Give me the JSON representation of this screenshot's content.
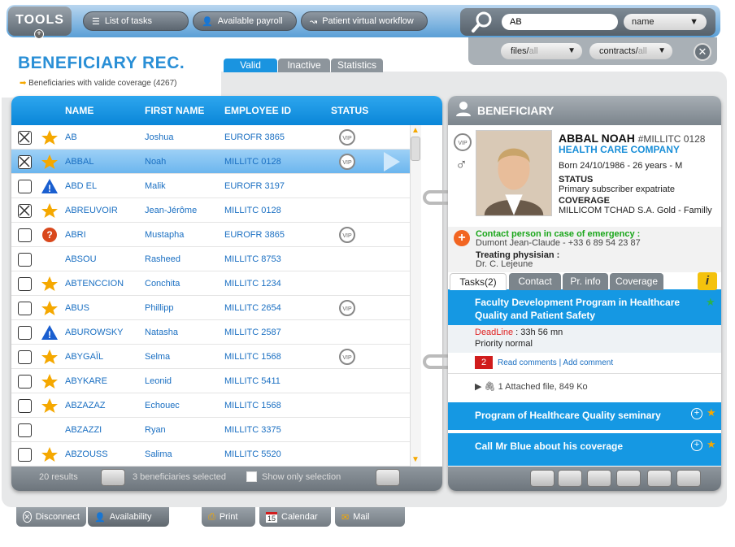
{
  "toolbar": {
    "tools_label": "TOOLS"
  },
  "nav": {
    "list_of_tasks": "List of tasks",
    "available_payroll": "Available payroll",
    "patient_workflow": "Patient virtual workflow"
  },
  "search": {
    "value": "AB",
    "field": "name"
  },
  "filters": {
    "files_label": "files/",
    "files_value": "all",
    "contracts_label": "contracts/",
    "contracts_value": "all"
  },
  "page": {
    "title": "BENEFICIARY REC.",
    "subtitle": "Beneficiaries with valide coverage (4267)"
  },
  "tabs": [
    "Valid",
    "Inactive",
    "Statistics"
  ],
  "table": {
    "headers": [
      "NAME",
      "FIRST NAME",
      "EMPLOYEE ID",
      "STATUS"
    ],
    "rows": [
      {
        "name": "AB",
        "first": "Joshua",
        "id": "EUROFR 3865",
        "checked": true,
        "icon": "star-icon",
        "vip": true
      },
      {
        "name": "ABBAL",
        "first": "Noah",
        "id": "MILLITC 0128",
        "checked": true,
        "icon": "star-icon",
        "vip": true,
        "selected": true
      },
      {
        "name": "ABD EL",
        "first": "Malik",
        "id": "EUROFR 3197",
        "checked": false,
        "icon": "warning-icon",
        "vip": false
      },
      {
        "name": "ABREUVOIR",
        "first": "Jean-Jérôme",
        "id": "MILLITC 0128",
        "checked": true,
        "icon": "star-icon",
        "vip": false
      },
      {
        "name": "ABRI",
        "first": "Mustapha",
        "id": "EUROFR 3865",
        "checked": false,
        "icon": "question-icon",
        "vip": true
      },
      {
        "name": "ABSOU",
        "first": "Rasheed",
        "id": "MILLITC 8753",
        "checked": false,
        "icon": "",
        "vip": false
      },
      {
        "name": "ABTENCCION",
        "first": "Conchita",
        "id": "MILLITC 1234",
        "checked": false,
        "icon": "star-icon",
        "vip": false
      },
      {
        "name": "ABUS",
        "first": "Phillipp",
        "id": "MILLITC 2654",
        "checked": false,
        "icon": "star-icon",
        "vip": true
      },
      {
        "name": "ABUROWSKY",
        "first": "Natasha",
        "id": "MILLITC 2587",
        "checked": false,
        "icon": "warning-icon",
        "vip": false
      },
      {
        "name": "ABYGAÏL",
        "first": "Selma",
        "id": "MILLITC 1568",
        "checked": false,
        "icon": "star-icon",
        "vip": true
      },
      {
        "name": "ABYKARE",
        "first": "Leonid",
        "id": "MILLITC 5411",
        "checked": false,
        "icon": "star-icon",
        "vip": false
      },
      {
        "name": "ABZAZAZ",
        "first": "Echouec",
        "id": "MILLITC 1568",
        "checked": false,
        "icon": "star-icon",
        "vip": false
      },
      {
        "name": "ABZAZZI",
        "first": "Ryan",
        "id": "MILLITC 3375",
        "checked": false,
        "icon": "",
        "vip": false
      },
      {
        "name": "ABZOUSS",
        "first": "Salima",
        "id": "MILLITC 5520",
        "checked": false,
        "icon": "star-icon",
        "vip": false
      }
    ],
    "vip_label": "VIP"
  },
  "listfooter": {
    "results": "20 results",
    "selected": "3 beneficiaries selected",
    "show_only": "Show only selection"
  },
  "beneficiary": {
    "header": "BENEFICIARY",
    "name": "ABBAL NOAH",
    "id": "#MILLITC 0128",
    "company": "HEALTH CARE COMPANY",
    "born": "Born 24/10/1986 - 26 years - M",
    "status_label": "STATUS",
    "status": "Primary subscriber expatriate",
    "coverage_label": "COVERAGE",
    "coverage": "MILLICOM TCHAD S.A. Gold - Familly",
    "emergency_label": "Contact person in case of emergency :",
    "emergency": "Dumont Jean-Claude - +33 6 89 54 23 87",
    "physician_label": "Treating physisian :",
    "physician": "Dr. C. Lejeune"
  },
  "btabs": [
    "Tasks(2)",
    "Contact",
    "Pr. info",
    "Coverage"
  ],
  "tasks": {
    "t1_title": "Faculty Development Program in Healthcare Quality and Patient Safety",
    "deadline_label": "DeadLine",
    "deadline": " : 33h 56 mn",
    "priority": "Priority normal",
    "comments_count": "2",
    "read_comments": "Read comments",
    "add_comment": "Add comment",
    "attached": "1 Attached file, 849 Ko",
    "t2_title": "Program of Healthcare Quality seminary",
    "t3_title": "Call Mr Blue about his coverage"
  },
  "bottom": {
    "disconnect": "Disconnect",
    "availability": "Availability",
    "print": "Print",
    "calendar": "Calendar",
    "calendar_day": "15",
    "mail": "Mail"
  },
  "colors": {
    "accent": "#1598e3",
    "title": "#2a8fd6",
    "star": "#f5a800",
    "deadline": "#e02020",
    "emergency": "#1aa61a"
  }
}
